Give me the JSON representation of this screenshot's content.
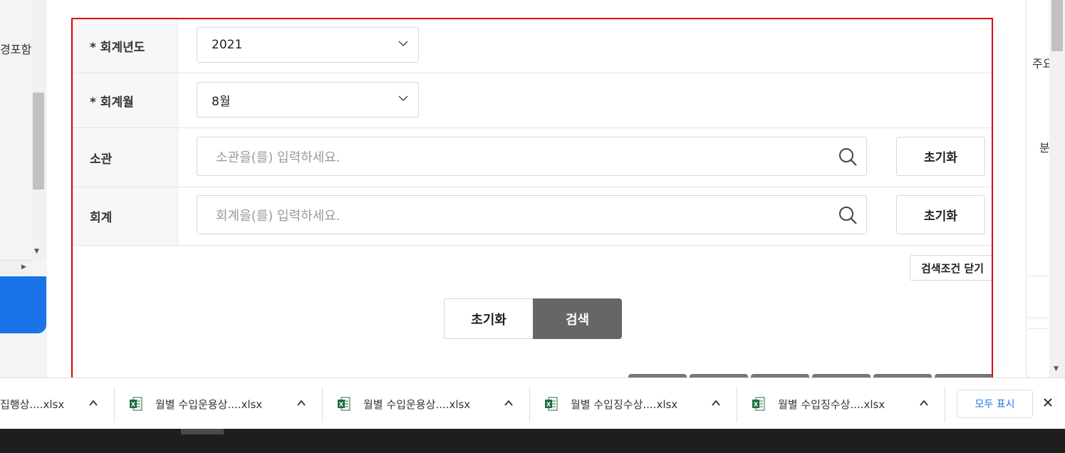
{
  "left_panel": {
    "fragment_text": "경포함"
  },
  "form": {
    "fiscal_year": {
      "label": "* 회계년도",
      "value": "2021"
    },
    "fiscal_month": {
      "label": "* 회계월",
      "value": "8월"
    },
    "agency": {
      "label": "소관",
      "placeholder": "소관을(를) 입력하세요.",
      "reset_label": "초기화"
    },
    "account": {
      "label": "회계",
      "placeholder": "회계을(를) 입력하세요.",
      "reset_label": "초기화"
    },
    "close_conditions_label": "검색조건 닫기",
    "reset_label": "초기화",
    "search_label": "검색"
  },
  "right_panel": {
    "fragment_1": "주요",
    "fragment_2": "분"
  },
  "download_bar": {
    "items": [
      {
        "name": "집행상....xlsx",
        "icon": "excel-icon"
      },
      {
        "name": "월별 수입운용상....xlsx",
        "icon": "excel-icon"
      },
      {
        "name": "월별 수입운용상....xlsx",
        "icon": "excel-icon"
      },
      {
        "name": "월별 수입징수상....xlsx",
        "icon": "excel-icon"
      },
      {
        "name": "월별 수입징수상....xlsx",
        "icon": "excel-icon"
      }
    ],
    "show_all_label": "모두 표시"
  },
  "colors": {
    "highlight_border": "#e00000",
    "search_button": "#666666",
    "link_blue": "#1a73e8",
    "excel_green": "#1d6f42"
  }
}
